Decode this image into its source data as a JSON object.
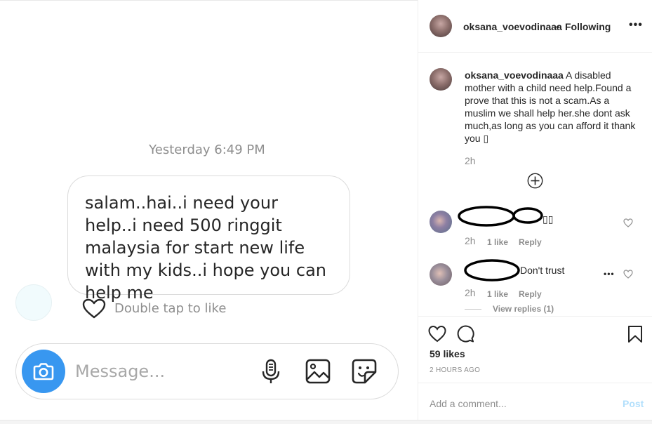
{
  "dm": {
    "timestamp": "Yesterday 6:49 PM",
    "message": "salam..hai..i need your help..i need 500 ringgit malaysia for start new life with my kids..i hope you can help me",
    "double_tap": "Double tap to like",
    "message_placeholder": "Message...",
    "icons": [
      "camera-icon",
      "microphone-icon",
      "gallery-icon",
      "sticker-icon",
      "heart-icon"
    ]
  },
  "post": {
    "username": "oksana_voevodinaaa",
    "separator": "•",
    "follow_state": "Following",
    "more": "•••",
    "caption_user": "oksana_voevodinaaa",
    "caption_text": " A disabled mother with a child need help.Found a prove that this is not a scam.As a muslim we shall help her.she dont ask much,as long as you can afford it thank you ▯",
    "caption_time": "2h",
    "comments": [
      {
        "text": "▯▯",
        "time": "2h",
        "likes": "1 like",
        "reply": "Reply"
      },
      {
        "text": "Don't trust",
        "time": "2h",
        "likes": "1 like",
        "reply": "Reply",
        "more": "•••",
        "view_replies": "View replies (1)"
      }
    ],
    "likes": "59 likes",
    "time_ago": "2 HOURS AGO",
    "add_comment_placeholder": "Add a comment...",
    "post_label": "Post"
  },
  "colors": {
    "accent": "#3897f0",
    "muted": "#8e8e8e",
    "border": "#dbdbdb",
    "post_disabled": "#b2dffc"
  }
}
